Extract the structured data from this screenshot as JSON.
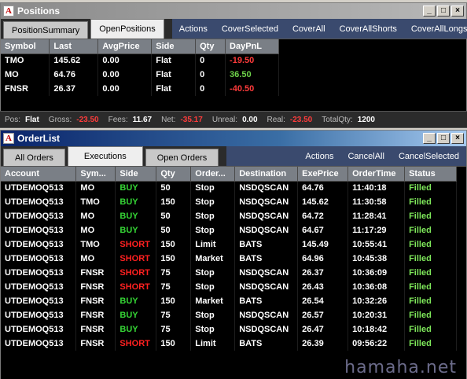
{
  "positions_window": {
    "title": "Positions",
    "tabs": [
      "PositionSummary",
      "OpenPositions"
    ],
    "actions": [
      "Actions",
      "CoverSelected",
      "CoverAll",
      "CoverAllShorts",
      "CoverAllLongs"
    ],
    "columns": [
      "Symbol",
      "Last",
      "AvgPrice",
      "Side",
      "Qty",
      "DayPnL"
    ],
    "rows": [
      {
        "symbol": "TMO",
        "last": "145.62",
        "avgprice": "0.00",
        "side": "Flat",
        "qty": "0",
        "pnl": "-19.50",
        "pnl_sign": "neg"
      },
      {
        "symbol": "MO",
        "last": "64.76",
        "avgprice": "0.00",
        "side": "Flat",
        "qty": "0",
        "pnl": "36.50",
        "pnl_sign": "pos"
      },
      {
        "symbol": "FNSR",
        "last": "26.37",
        "avgprice": "0.00",
        "side": "Flat",
        "qty": "0",
        "pnl": "-40.50",
        "pnl_sign": "neg"
      }
    ]
  },
  "status_bar": {
    "pos_label": "Pos:",
    "pos_value": "Flat",
    "gross_label": "Gross:",
    "gross_value": "-23.50",
    "fees_label": "Fees:",
    "fees_value": "11.67",
    "net_label": "Net:",
    "net_value": "-35.17",
    "unreal_label": "Unreal:",
    "unreal_value": "0.00",
    "real_label": "Real:",
    "real_value": "-23.50",
    "totalqty_label": "TotalQty:",
    "totalqty_value": "1200"
  },
  "orders_window": {
    "title": "OrderList",
    "tabs": [
      "All Orders",
      "Executions",
      "Open Orders"
    ],
    "actions": [
      "Actions",
      "CancelAll",
      "CancelSelected"
    ],
    "columns": [
      "Account",
      "Sym...",
      "Side",
      "Qty",
      "Order...",
      "Destination",
      "ExePrice",
      "OrderTime",
      "Status"
    ],
    "rows": [
      [
        "UTDEMOQ513",
        "MO",
        "BUY",
        "50",
        "Stop",
        "NSDQSCAN",
        "64.76",
        "11:40:18",
        "Filled"
      ],
      [
        "UTDEMOQ513",
        "TMO",
        "BUY",
        "150",
        "Stop",
        "NSDQSCAN",
        "145.62",
        "11:30:58",
        "Filled"
      ],
      [
        "UTDEMOQ513",
        "MO",
        "BUY",
        "50",
        "Stop",
        "NSDQSCAN",
        "64.72",
        "11:28:41",
        "Filled"
      ],
      [
        "UTDEMOQ513",
        "MO",
        "BUY",
        "50",
        "Stop",
        "NSDQSCAN",
        "64.67",
        "11:17:29",
        "Filled"
      ],
      [
        "UTDEMOQ513",
        "TMO",
        "SHORT",
        "150",
        "Limit",
        "BATS",
        "145.49",
        "10:55:41",
        "Filled"
      ],
      [
        "UTDEMOQ513",
        "MO",
        "SHORT",
        "150",
        "Market",
        "BATS",
        "64.96",
        "10:45:38",
        "Filled"
      ],
      [
        "UTDEMOQ513",
        "FNSR",
        "SHORT",
        "75",
        "Stop",
        "NSDQSCAN",
        "26.37",
        "10:36:09",
        "Filled"
      ],
      [
        "UTDEMOQ513",
        "FNSR",
        "SHORT",
        "75",
        "Stop",
        "NSDQSCAN",
        "26.43",
        "10:36:08",
        "Filled"
      ],
      [
        "UTDEMOQ513",
        "FNSR",
        "BUY",
        "150",
        "Market",
        "BATS",
        "26.54",
        "10:32:26",
        "Filled"
      ],
      [
        "UTDEMOQ513",
        "FNSR",
        "BUY",
        "75",
        "Stop",
        "NSDQSCAN",
        "26.57",
        "10:20:31",
        "Filled"
      ],
      [
        "UTDEMOQ513",
        "FNSR",
        "BUY",
        "75",
        "Stop",
        "NSDQSCAN",
        "26.47",
        "10:18:42",
        "Filled"
      ],
      [
        "UTDEMOQ513",
        "FNSR",
        "SHORT",
        "150",
        "Limit",
        "BATS",
        "26.39",
        "09:56:22",
        "Filled"
      ]
    ]
  },
  "watermark": "hamaha.net",
  "window_buttons": {
    "minimize": "_",
    "maximize": "□",
    "close": "×"
  },
  "app_icon_letter": "A"
}
